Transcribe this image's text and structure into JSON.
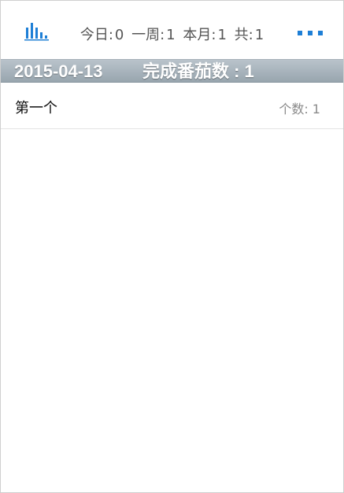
{
  "header": {
    "chart_icon": "bar-chart-icon",
    "stats": [
      {
        "label": "今日:",
        "value": "0"
      },
      {
        "label": "一周:",
        "value": "1"
      },
      {
        "label": "本月:",
        "value": "1"
      },
      {
        "label": "共:",
        "value": "1"
      }
    ],
    "more_icon": "more-dots-icon"
  },
  "section": {
    "date": "2015-04-13",
    "count_label": "完成番茄数 : 1"
  },
  "list": [
    {
      "title": "第一个",
      "count_label": "个数: 1"
    }
  ],
  "colors": {
    "accent": "#1e7fd6",
    "header_gradient_top": "#b9c3cb",
    "header_gradient_bottom": "#98a5ae"
  }
}
